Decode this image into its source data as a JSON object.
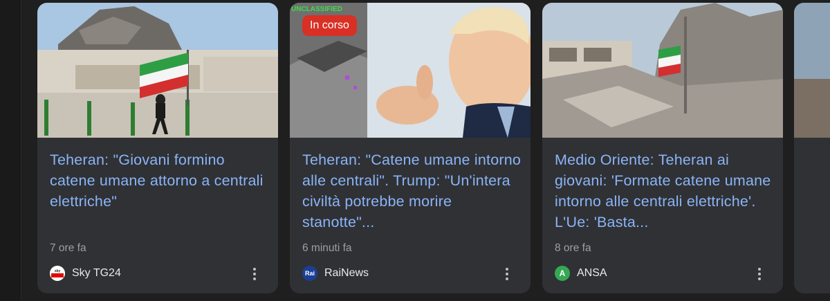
{
  "cards": [
    {
      "title": "Teheran: \"Giovani formino catene umane attorno a centrali elettriche\"",
      "time": "7 ore fa",
      "source": "Sky TG24",
      "source_logo_text": "sky tg24",
      "source_logo_color": "#e10600"
    },
    {
      "badge": "In corso",
      "image_caption": "UNCLASSIFIED",
      "title": "Teheran: \"Catene umane intorno alle centrali\". Trump: \"Un'intera civiltà potrebbe morire stanotte\"...",
      "time": "6 minuti fa",
      "source": "RaiNews",
      "source_logo_text": "Rai",
      "source_logo_color": "#1c3f94"
    },
    {
      "title": "Medio Oriente: Teheran ai giovani: 'Formate catene umane intorno alle centrali elettriche'. L'Ue: 'Basta...",
      "time": "8 ore fa",
      "source": "ANSA",
      "source_logo_text": "A",
      "source_logo_color": "#34a853"
    }
  ],
  "colors": {
    "background": "#1f1f1f",
    "card": "#303134",
    "title": "#8ab4f8",
    "meta": "#9aa0a6",
    "badge": "#d93025"
  }
}
